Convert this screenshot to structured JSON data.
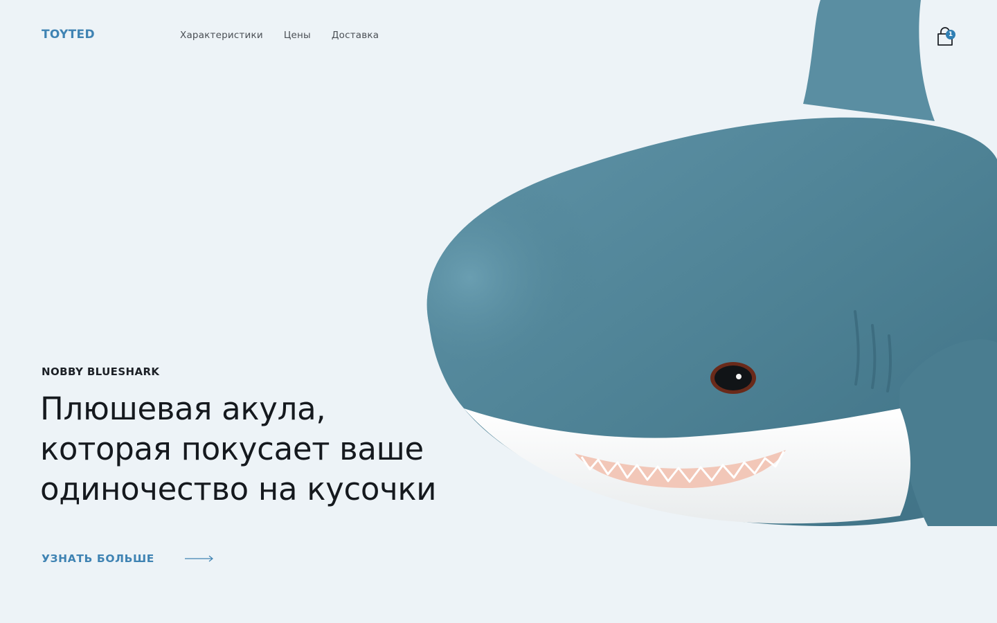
{
  "header": {
    "logo": "TOYTED",
    "nav": [
      "Характеристики",
      "Цены",
      "Доставка"
    ],
    "cart_count": "1",
    "cart_icon": "shopping-bag-icon"
  },
  "hero": {
    "subtitle": "NOBBY BLUESHARK",
    "headline_lines": [
      "Плюшевая акула,",
      "которая покусает ваше",
      "одиночество на кусочки"
    ],
    "cta_label": "УЗНАТЬ БОЛЬШЕ",
    "cta_icon": "arrow-right-icon",
    "image": "plush-shark-image"
  },
  "colors": {
    "background": "#edf3f7",
    "accent": "#3f83b3",
    "shark_body": "#4f8296",
    "shark_belly": "#f5f6f6"
  }
}
